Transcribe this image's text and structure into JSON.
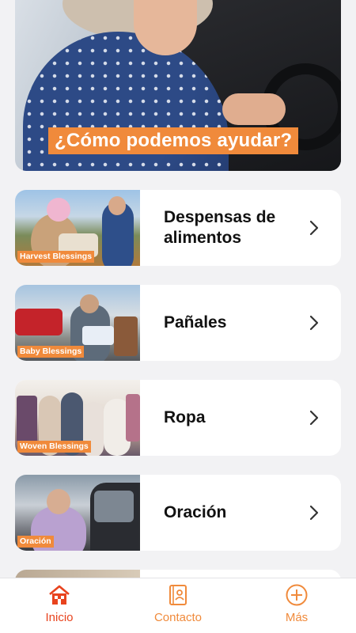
{
  "hero": {
    "title": "¿Cómo podemos ayudar?"
  },
  "cards": [
    {
      "label": "Despensas de alimentos",
      "tag": "Harvest Blessings",
      "icon": "chevron-right-icon"
    },
    {
      "label": "Pañales",
      "tag": "Baby Blessings",
      "icon": "chevron-right-icon"
    },
    {
      "label": "Ropa",
      "tag": "Woven Blessings",
      "icon": "chevron-right-icon"
    },
    {
      "label": "Oración",
      "tag": "Oración",
      "icon": "chevron-right-icon"
    }
  ],
  "tabbar": {
    "items": [
      {
        "label": "Inicio",
        "icon": "home-icon",
        "active": true
      },
      {
        "label": "Contacto",
        "icon": "contact-book-icon",
        "active": false
      },
      {
        "label": "Más",
        "icon": "plus-circle-icon",
        "active": false
      }
    ]
  },
  "colors": {
    "accent": "#f08a3b",
    "active": "#e8431e",
    "background": "#f2f2f4",
    "card": "#ffffff"
  }
}
